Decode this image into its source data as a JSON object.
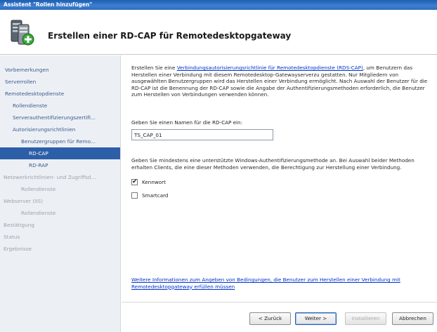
{
  "window": {
    "title": "Assistent \"Rollen hinzufügen\""
  },
  "header": {
    "title": "Erstellen einer RD-CAP für Remotedesktopgateway",
    "icon": "server-roles-icon"
  },
  "sidebar": {
    "items": [
      {
        "label": "Vorbemerkungen"
      },
      {
        "label": "Serverrollen"
      },
      {
        "label": "Remotedesktopdienste"
      },
      {
        "label": "Rollendienste"
      },
      {
        "label": "Serverauthentifizierungszertifi..."
      },
      {
        "label": "Autorisierungsrichtlinien"
      },
      {
        "label": "Benutzergruppen für Remo..."
      },
      {
        "label": "RD-CAP"
      },
      {
        "label": "RD-RAP"
      },
      {
        "label": "Netzwerkrichtlinien- und Zugriffsd..."
      },
      {
        "label": "Rollendienste"
      },
      {
        "label": "Webserver (IIS)"
      },
      {
        "label": "Rollendienste"
      },
      {
        "label": "Bestätigung"
      },
      {
        "label": "Status"
      },
      {
        "label": "Ergebnisse"
      }
    ]
  },
  "main": {
    "intro_pre": "Erstellen Sie eine ",
    "intro_link": "Verbindungsautorisierungsrichtlinie für Remotedesktopdienste (RDS-CAP)",
    "intro_post": ", um Benutzern das Herstellen einer Verbindung mit diesem Remotedesktop-Gatewayserverzu gestatten. Nur Mitgliedern von ausgewählten Benutzergruppen wird das Herstellen einer Verbindung ermöglicht. Nach Auswahl der Benutzer für die RD-CAP ist die Benennung der RD-CAP sowie die Angabe der Authentifizierungsmethoden erforderlich, die Benutzer zum Herstellen von Verbindungen verwenden können.",
    "name_label": "Geben Sie einen Namen für die RD-CAP ein:",
    "name_value": "TS_CAP_01",
    "auth_text": "Geben Sie mindestens eine unterstützte Windows-Authentifizierungsmethode an. Bei Auswahl beider Methoden erhalten Clients, die eine dieser Methoden verwenden, die Berechtigung zur Herstellung einer Verbindung.",
    "password_label": "Kennwort",
    "password_checked": true,
    "smartcard_label": "Smartcard",
    "smartcard_checked": false,
    "more_link": "Weitere Informationen zum Angeben von Bedingungen, die Benutzer zum Herstellen einer Verbindung mit Remotedesktopgateway erfüllen müssen"
  },
  "buttons": {
    "back": "< Zurück",
    "next": "Weiter >",
    "install": "Installieren",
    "cancel": "Abbrechen"
  }
}
